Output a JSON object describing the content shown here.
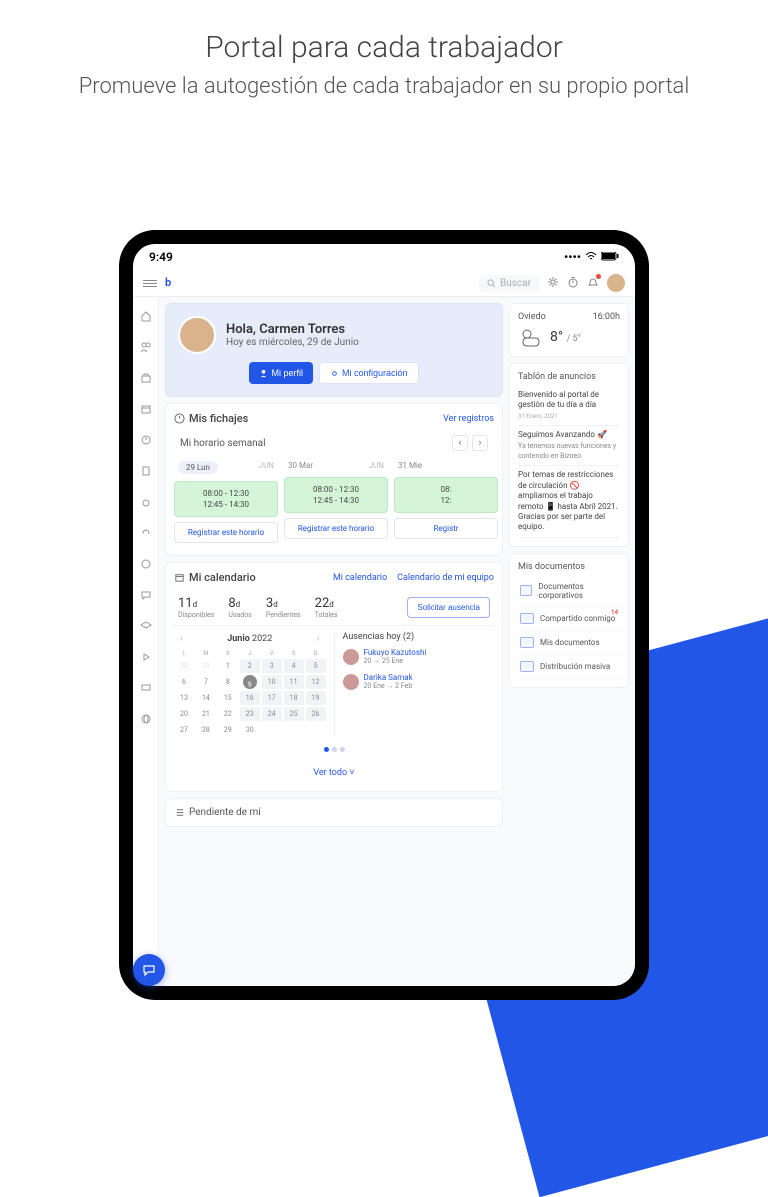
{
  "hero": {
    "title": "Portal para cada trabajador",
    "subtitle": "Promueve la autogestión de cada trabajador en su propio portal"
  },
  "status": {
    "time": "9:49"
  },
  "search": {
    "placeholder": "Buscar"
  },
  "greeting": {
    "hello": "Hola, Carmen Torres",
    "date": "Hoy es miércoles, 29 de Junio",
    "profile_btn": "Mi perfil",
    "config_btn": "Mi configuración"
  },
  "fichajes": {
    "title": "Mis fichajes",
    "link": "Ver registros",
    "week_label": "Mi horario semanal",
    "days": [
      {
        "label": "29 Lun",
        "month": "JUN",
        "t1": "08:00 - 12:30",
        "t2": "12:45 - 14:30",
        "btn": "Registrar este horario",
        "active": true
      },
      {
        "label": "30 Mar",
        "month": "JUN",
        "t1": "08:00 - 12:30",
        "t2": "12:45 - 14:30",
        "btn": "Registrar este horario"
      },
      {
        "label": "31 Mie",
        "month": "",
        "t1": "08:",
        "t2": "12:",
        "btn": "Registr"
      }
    ]
  },
  "calendario": {
    "title": "Mi calendario",
    "tab1": "Mi calendario",
    "tab2": "Calendario de mi equipo",
    "stats": [
      {
        "n": "11",
        "u": "d",
        "l": "Disponibles"
      },
      {
        "n": "8",
        "u": "d",
        "l": "Usados"
      },
      {
        "n": "3",
        "u": "d",
        "l": "Pendientes"
      },
      {
        "n": "22",
        "u": "d",
        "l": "Totales"
      }
    ],
    "absence_btn": "Solicitar ausencia",
    "month": "Junio",
    "year": "2022",
    "dows": [
      "L",
      "M",
      "X",
      "J",
      "V",
      "S",
      "D"
    ],
    "absences_title": "Ausencias hoy (2)",
    "absences": [
      {
        "name": "Fukuyo Kazutoshi",
        "date": "20 → 25 Ene"
      },
      {
        "name": "Darika Samak",
        "date": "20 Ene → 2 Feb"
      }
    ],
    "ver_todo": "Ver todo"
  },
  "pending": {
    "title": "Pendiente de mí"
  },
  "weather": {
    "city": "Oviedo",
    "time": "16:00h",
    "hi": "8°",
    "lo": "/ 5°"
  },
  "board": {
    "title": "Tablón de anuncios",
    "items": [
      {
        "text": "Bienvenido al portal de gestión de tu día a día",
        "date": "31 Enero, 2021"
      },
      {
        "text": "Seguimos Avanzando 🚀",
        "sub": "Ya tenemos nuevas funciones y contenido en Bizneo"
      },
      {
        "text": "Por temas de restricciones de circulación 🚫 ampliamos el trabajo remoto 📱 hasta Abril 2021. Gracias por ser parte del equipo."
      }
    ]
  },
  "docs": {
    "title": "Mis documentos",
    "items": [
      {
        "label": "Documentos corporativos"
      },
      {
        "label": "Compartido conmigo",
        "badge": "14"
      },
      {
        "label": "Mis documentos"
      },
      {
        "label": "Distribución masiva"
      }
    ]
  }
}
